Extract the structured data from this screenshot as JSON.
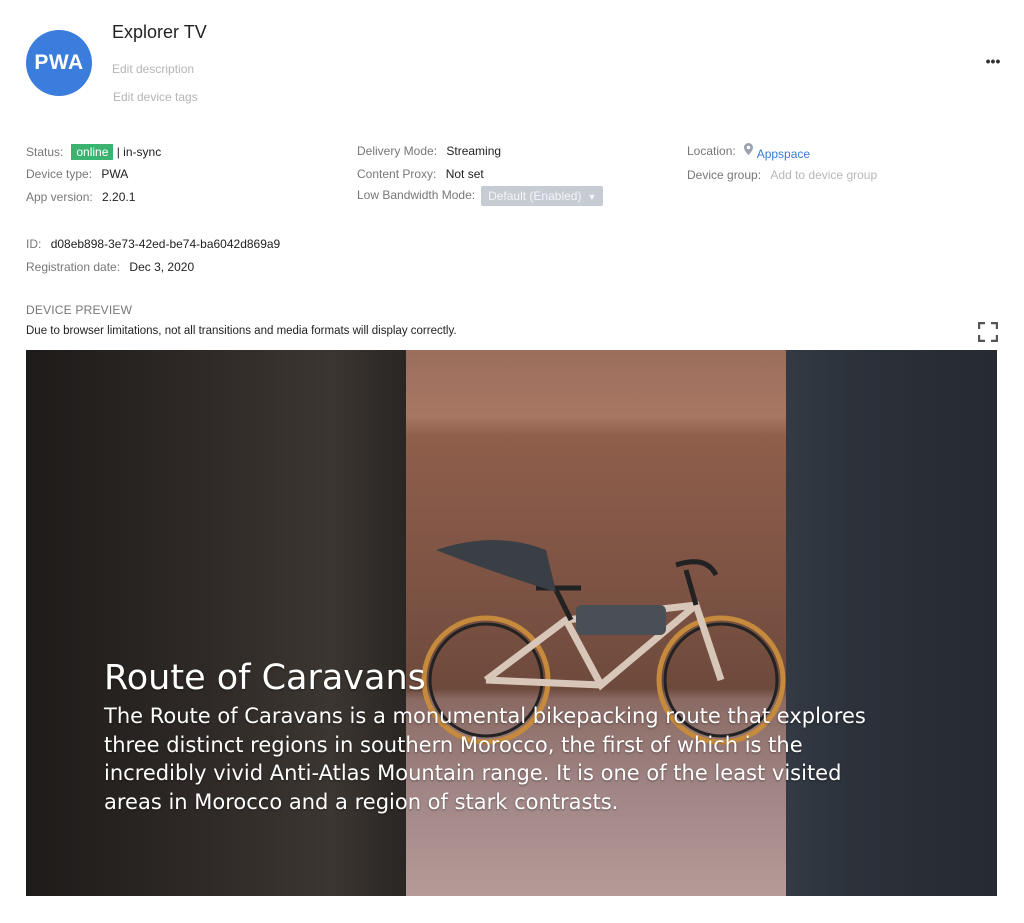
{
  "device": {
    "avatar_text": "PWA",
    "name": "Explorer TV",
    "edit_description": "Edit description",
    "edit_tags": "Edit device tags",
    "more_icon": "more-options-icon"
  },
  "info": {
    "status_label": "Status:",
    "status_badge": "online",
    "status_sync": "| in-sync",
    "device_type_label": "Device type:",
    "device_type": "PWA",
    "app_version_label": "App version:",
    "app_version": "2.20.1",
    "delivery_mode_label": "Delivery Mode:",
    "delivery_mode": "Streaming",
    "content_proxy_label": "Content Proxy:",
    "content_proxy": "Not set",
    "low_bandwidth_label": "Low Bandwidth Mode:",
    "low_bandwidth_value": "Default (Enabled)",
    "location_label": "Location:",
    "location_value": "Appspace",
    "device_group_label": "Device group:",
    "device_group_placeholder": "Add to device group",
    "id_label": "ID:",
    "id_value": "d08eb898-3e73-42ed-be74-ba6042d869a9",
    "registration_label": "Registration date:",
    "registration_value": "Dec 3, 2020"
  },
  "preview": {
    "section_title": "DEVICE PREVIEW",
    "notice": "Due to browser limitations, not all transitions and media formats will display correctly.",
    "slide_title": "Route of Caravans",
    "slide_body": "The Route of Caravans is a monumental bikepacking route that explores three distinct regions in southern Morocco, the first of which is the incredibly vivid Anti-Atlas Mountain range. It is one of the least visited areas in Morocco and a region of stark contrasts."
  },
  "colors": {
    "avatar": "#3b7ddd",
    "badge_online": "#3cb371",
    "link": "#3a7bd5"
  }
}
